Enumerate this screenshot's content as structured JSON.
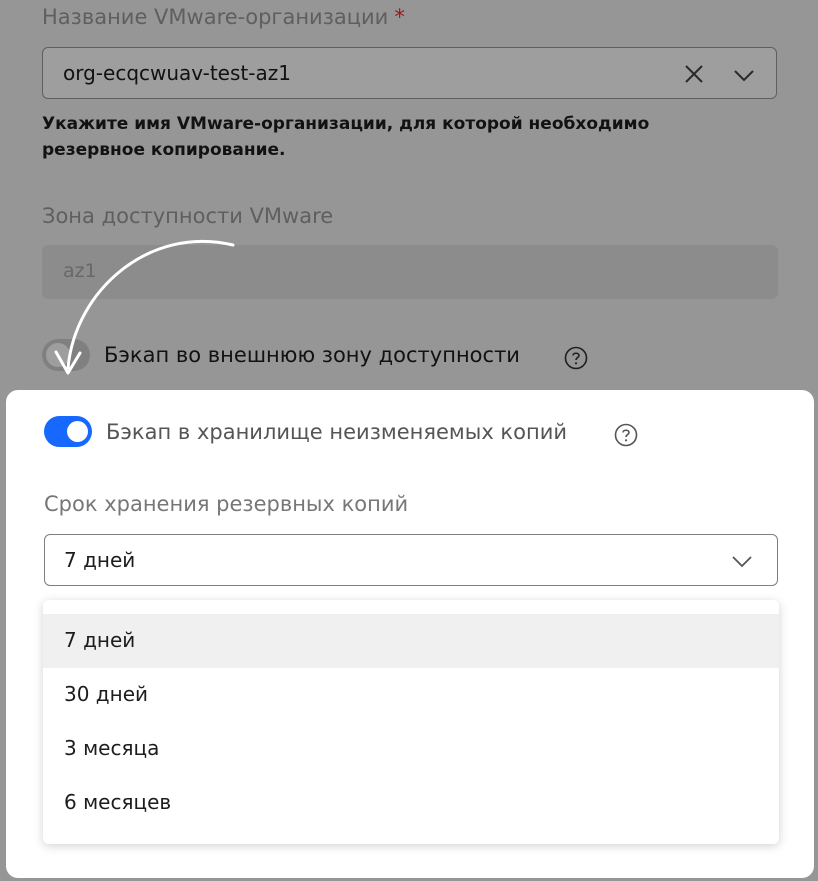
{
  "org": {
    "label": "Название VMware-организации",
    "required_mark": "*",
    "value": "org-ecqcwuav-test-az1",
    "hint": "Укажите имя VMware-организации, для которой необходимо резервное копирование."
  },
  "zone": {
    "label": "Зона доступности VMware",
    "value": "az1"
  },
  "external_backup": {
    "label": "Бэкап во внешнюю зону доступности",
    "enabled": false
  },
  "immutable_backup": {
    "label": "Бэкап в хранилище неизменяемых копий",
    "enabled": true
  },
  "retention": {
    "label": "Срок хранения резервных копий",
    "selected": "7 дней",
    "options": [
      "7 дней",
      "30 дней",
      "3 месяца",
      "6 месяцев"
    ]
  },
  "colors": {
    "accent": "#1668ff",
    "required": "#ff2b2b"
  }
}
